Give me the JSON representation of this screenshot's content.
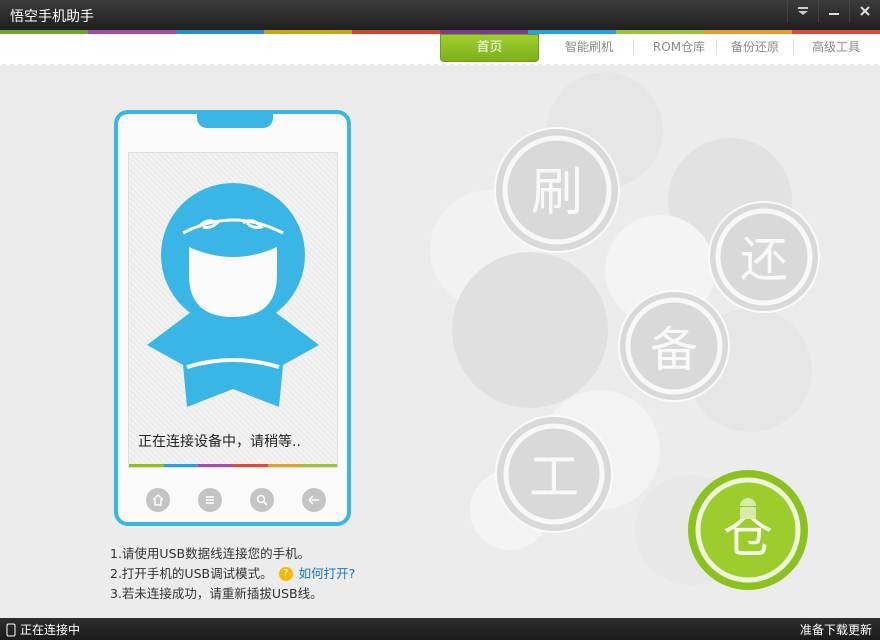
{
  "app": {
    "title": "悟空手机助手"
  },
  "nav": {
    "tabs": [
      {
        "label": "首页",
        "active": true
      },
      {
        "label": "智能刷机"
      },
      {
        "label": "ROM仓库"
      },
      {
        "label": "备份还原"
      },
      {
        "label": "高级工具"
      }
    ]
  },
  "phone": {
    "status_text": "正在连接设备中，请稍等.."
  },
  "instructions": {
    "line1": "1.请使用USB数据线连接您的手机。",
    "line2": "2.打开手机的USB调试模式。",
    "help_link": "如何打开?",
    "line3": "3.若未连接成功，请重新插拔USB线。"
  },
  "features": {
    "flash": "刷",
    "restore": "还",
    "backup": "备",
    "tools": "工",
    "warehouse": "仓"
  },
  "status": {
    "left": "正在连接中",
    "right": "准备下载更新"
  },
  "colors": {
    "accent_blue": "#3ab6e6",
    "accent_green": "#8cc21f",
    "strip": [
      "#5b9bd5",
      "#9b59b6",
      "#e74c3c",
      "#f39c12",
      "#2ecc71",
      "#1abc9c",
      "#e67e22",
      "#8e44ad",
      "#3498db",
      "#c0392b"
    ]
  }
}
